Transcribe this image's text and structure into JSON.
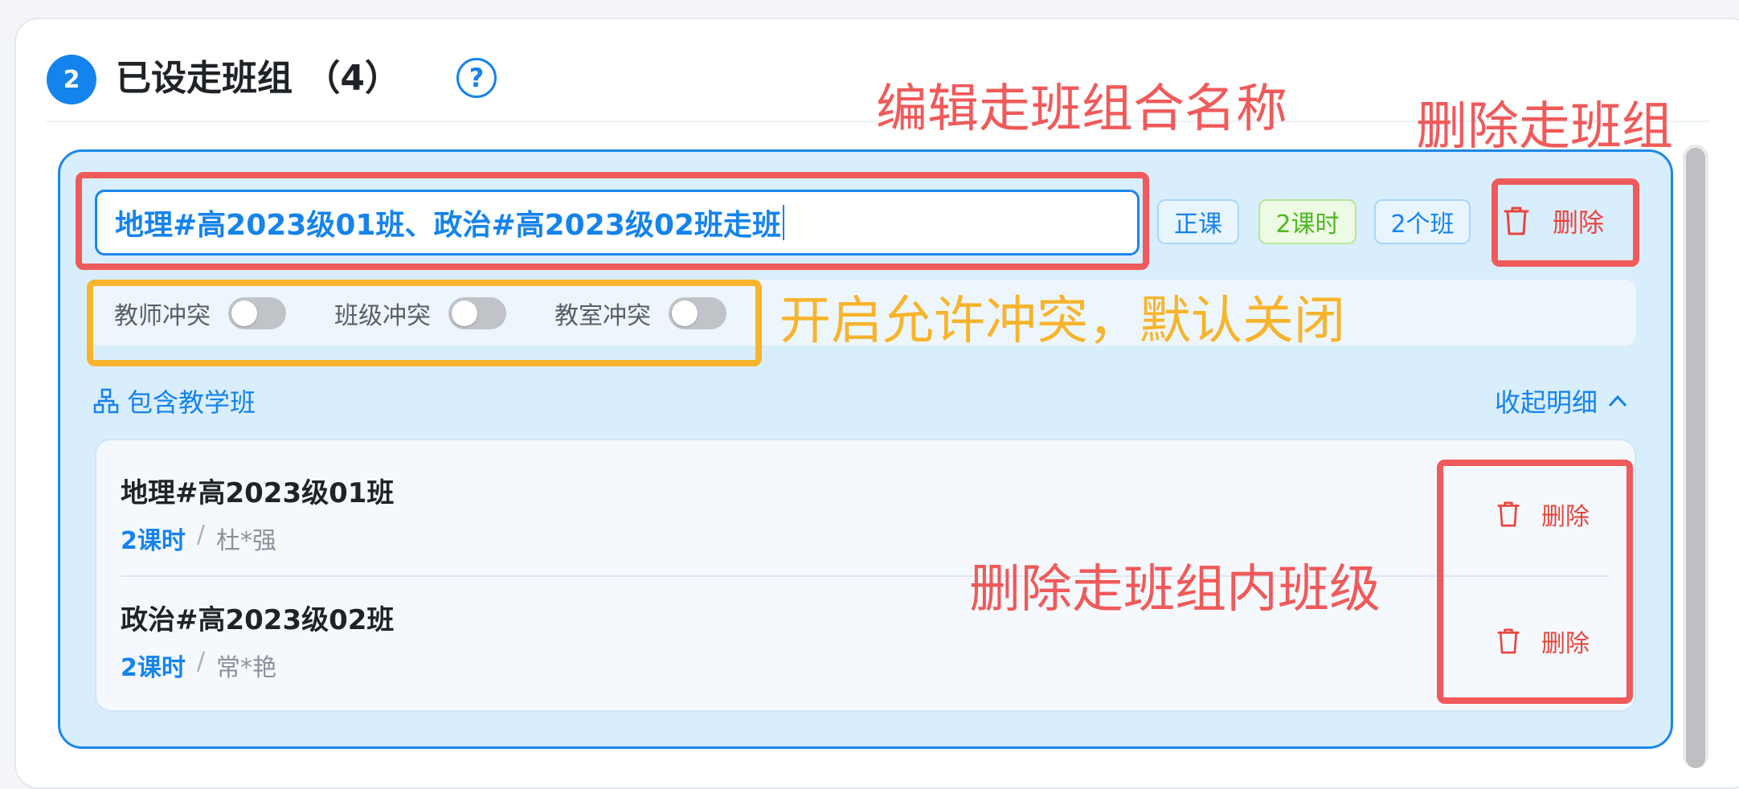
{
  "section": {
    "step_number": "2",
    "title": "已设走班组  （4）",
    "help_icon": "question-circle-icon"
  },
  "group": {
    "name_value": "地理#高2023级01班、政治#高2023级02班走班",
    "tags": {
      "course_type": "正课",
      "hours": "2课时",
      "class_count": "2个班"
    },
    "delete_label": "删除",
    "conflicts": [
      {
        "label": "教师冲突",
        "enabled": false
      },
      {
        "label": "班级冲突",
        "enabled": false
      },
      {
        "label": "教室冲突",
        "enabled": false
      }
    ],
    "include_title": "包含教学班",
    "include_icon": "org-tree-icon",
    "collapse_label": "收起明细",
    "collapse_icon": "chevron-up-icon",
    "classes": [
      {
        "name": "地理#高2023级01班",
        "hours": "2课时",
        "sep": "/",
        "teacher": "杜*强",
        "delete_label": "删除"
      },
      {
        "name": "政治#高2023级02班",
        "hours": "2课时",
        "sep": "/",
        "teacher": "常*艳",
        "delete_label": "删除"
      }
    ]
  },
  "annotations": {
    "edit_name": "编辑走班组合名称",
    "delete_group": "删除走班组",
    "conflict_note": "开启允许冲突，默认关闭",
    "delete_class": "删除走班组内班级"
  },
  "colors": {
    "primary": "#1583ec",
    "danger": "#e8453c",
    "success": "#4fb722",
    "annotation_red": "#f05a5a",
    "annotation_orange": "#f7b42c",
    "panel_bg": "#d9eefc"
  }
}
